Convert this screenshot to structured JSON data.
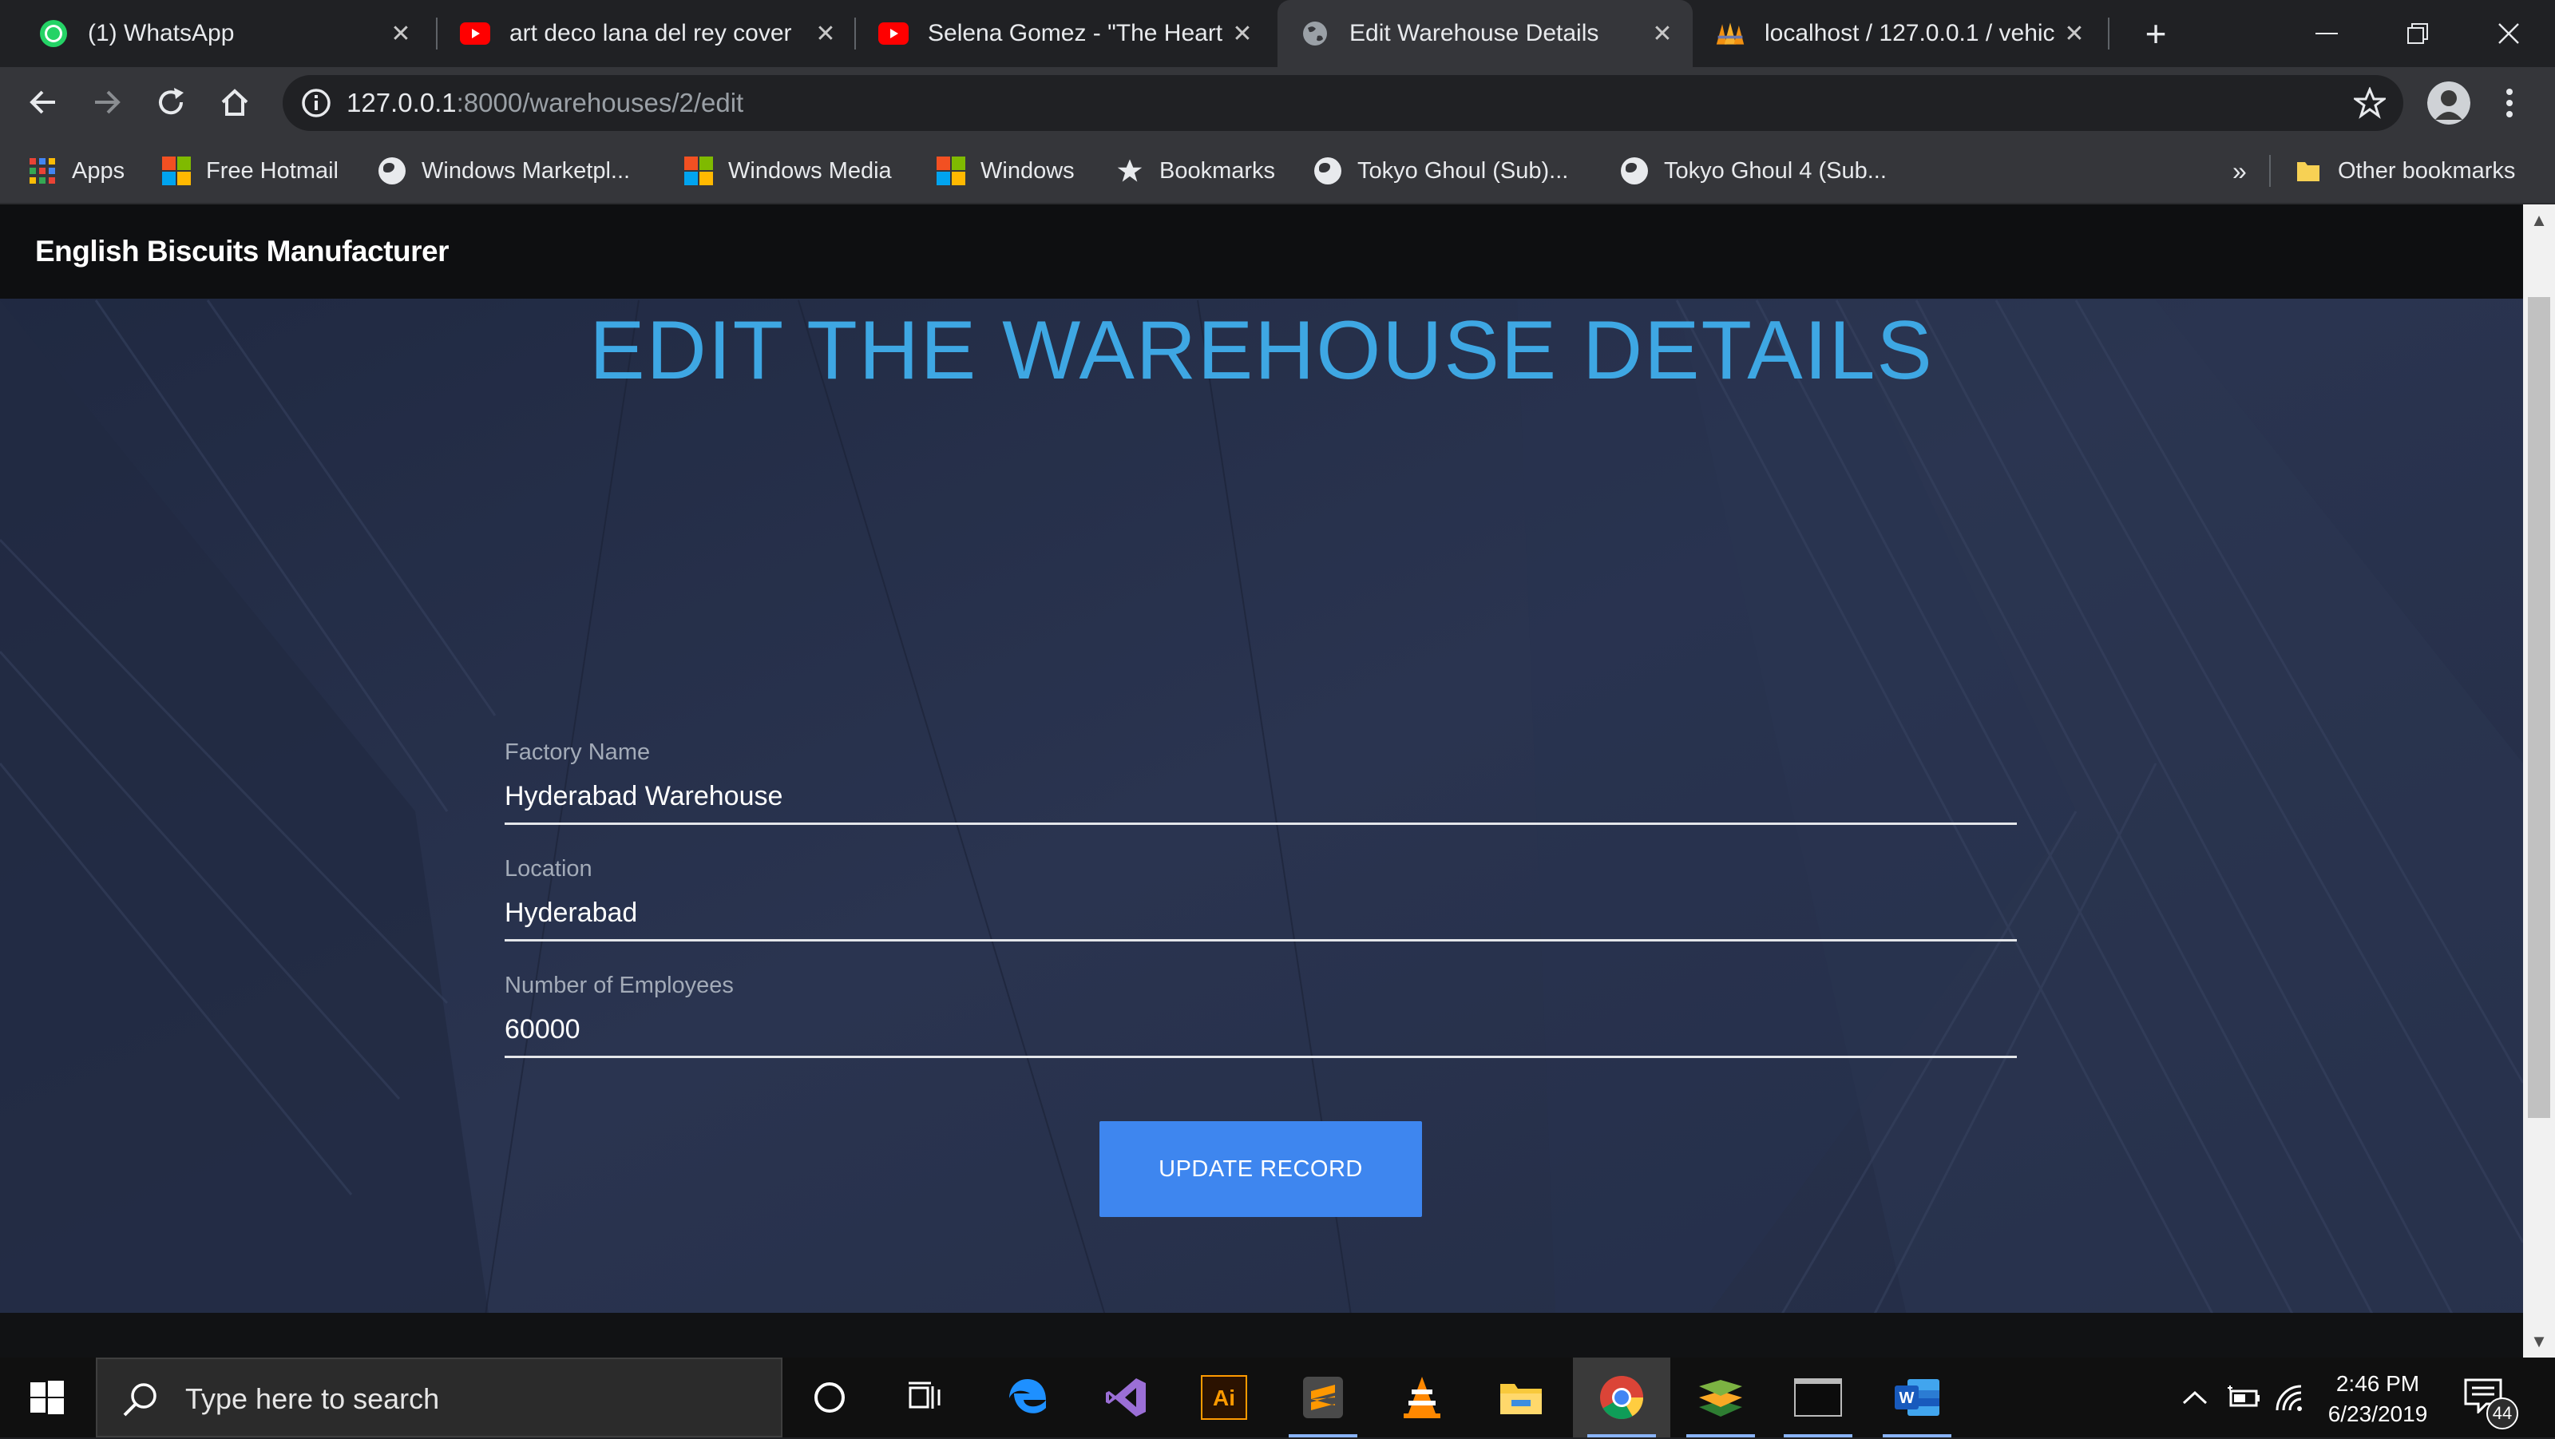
{
  "browser": {
    "tabs": [
      {
        "title": "(1) WhatsApp",
        "icon": "whatsapp-icon",
        "active": false
      },
      {
        "title": "art deco lana del rey cover",
        "icon": "youtube-icon",
        "active": false
      },
      {
        "title": "Selena Gomez - \"The Heart",
        "icon": "youtube-icon",
        "active": false
      },
      {
        "title": "Edit Warehouse Details",
        "icon": "globe-icon",
        "active": true
      },
      {
        "title": "localhost / 127.0.0.1 / vehic",
        "icon": "phpmyadmin-icon",
        "active": false
      }
    ],
    "url_host": "127.0.0.1",
    "url_rest": ":8000/warehouses/2/edit",
    "bookmarks": [
      {
        "label": "Apps",
        "icon": "apps-grid-icon"
      },
      {
        "label": "Free Hotmail",
        "icon": "windows-logo-icon"
      },
      {
        "label": "Windows Marketpl...",
        "icon": "globe-icon"
      },
      {
        "label": "Windows Media",
        "icon": "windows-logo-icon"
      },
      {
        "label": "Windows",
        "icon": "windows-logo-icon"
      },
      {
        "label": "Bookmarks",
        "icon": "star-icon"
      },
      {
        "label": "Tokyo Ghoul (Sub)...",
        "icon": "globe-icon"
      },
      {
        "label": "Tokyo Ghoul 4 (Sub...",
        "icon": "globe-icon"
      }
    ],
    "overflow_label": "»",
    "other_bookmarks": "Other bookmarks"
  },
  "site": {
    "brand": "English Biscuits Manufacturer",
    "heading": "EDIT THE WAREHOUSE DETAILS",
    "form": {
      "factory_name_label": "Factory Name",
      "factory_name_value": "Hyderabad Warehouse",
      "location_label": "Location",
      "location_value": "Hyderabad",
      "employees_label": "Number of Employees",
      "employees_value": "60000",
      "submit_label": "UPDATE RECORD"
    }
  },
  "taskbar": {
    "search_placeholder": "Type here to search",
    "time": "2:46 PM",
    "date": "6/23/2019",
    "notification_count": "44"
  },
  "colors": {
    "heading": "#3ea7e3",
    "button": "#3e86ef",
    "page_bg": "#262f45"
  }
}
